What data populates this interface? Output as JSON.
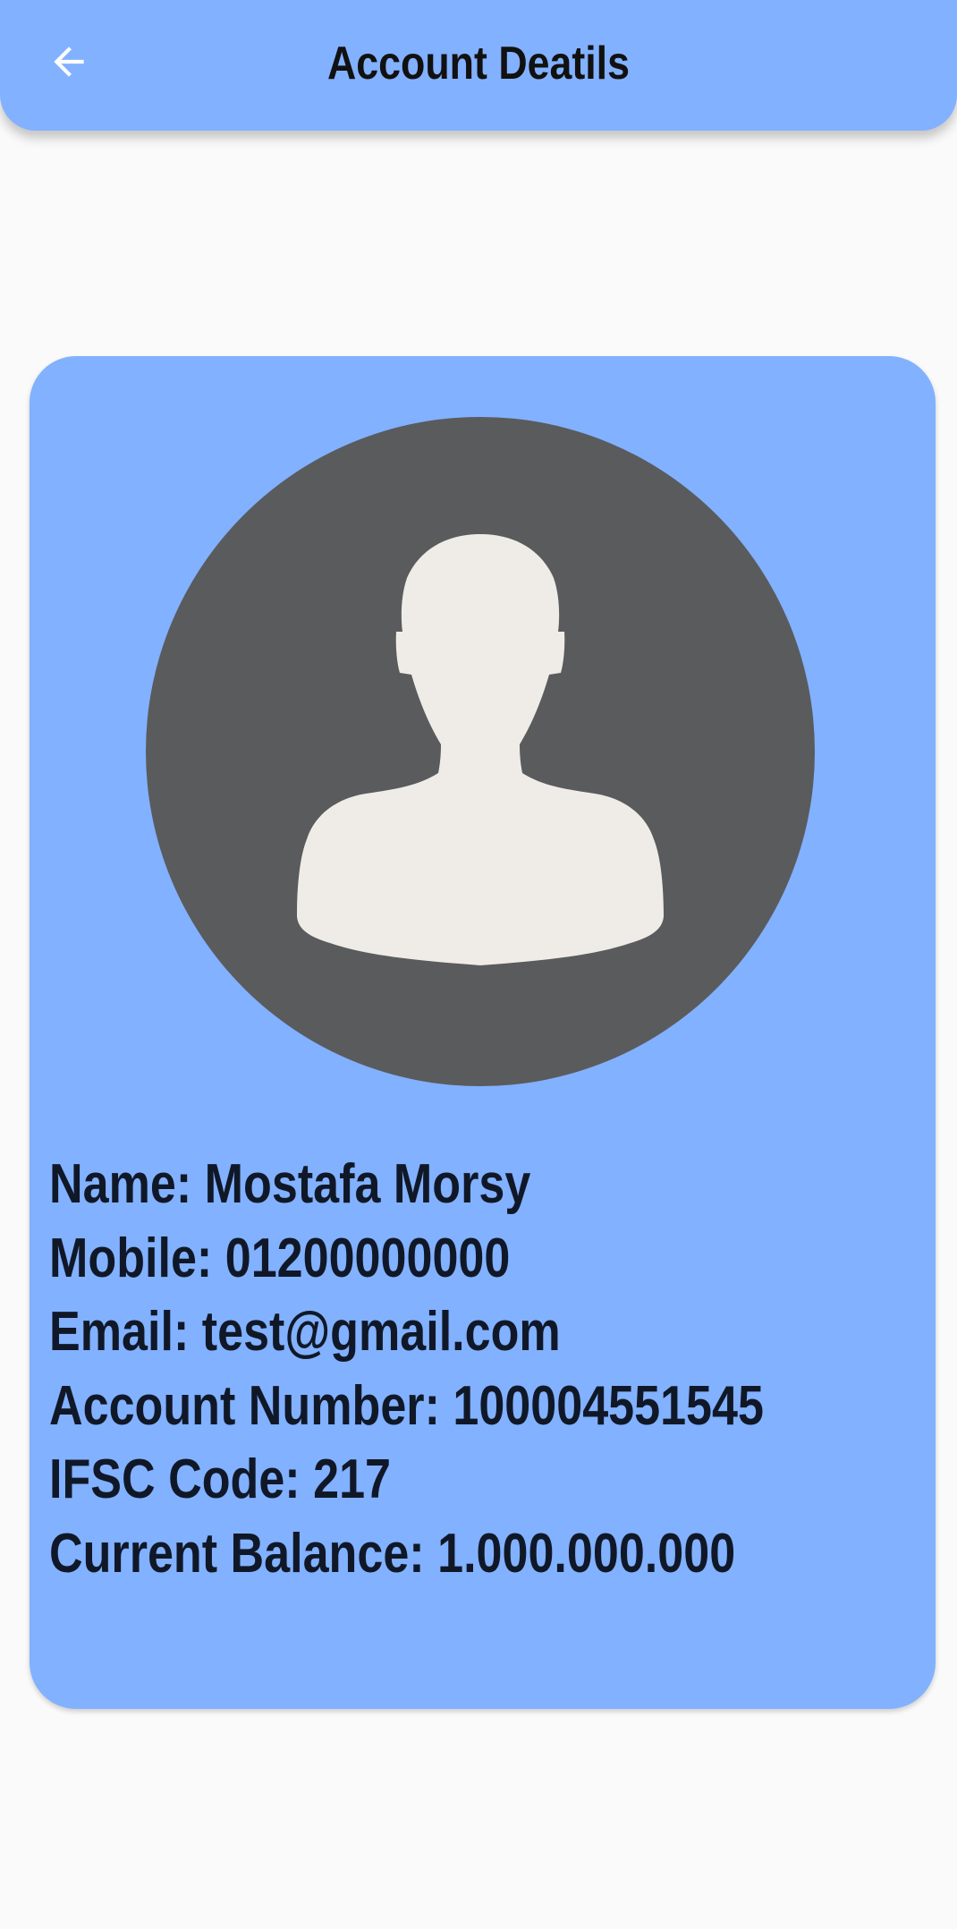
{
  "app_bar": {
    "title": "Account Deatils",
    "back_icon": "arrow-back-icon",
    "background_color": "#82b1ff"
  },
  "profile_card": {
    "background_color": "#82b1ff",
    "avatar": {
      "icon": "person-silhouette-icon",
      "background_color": "#5a5b5d",
      "figure_color": "#efece8"
    },
    "details": [
      "Name: Mostafa Morsy",
      "Mobile: 01200000000",
      "Email: test@gmail.com",
      "Account Number: 100004551545",
      "IFSC Code: 217",
      "Current Balance: 1.000.000.000"
    ]
  }
}
